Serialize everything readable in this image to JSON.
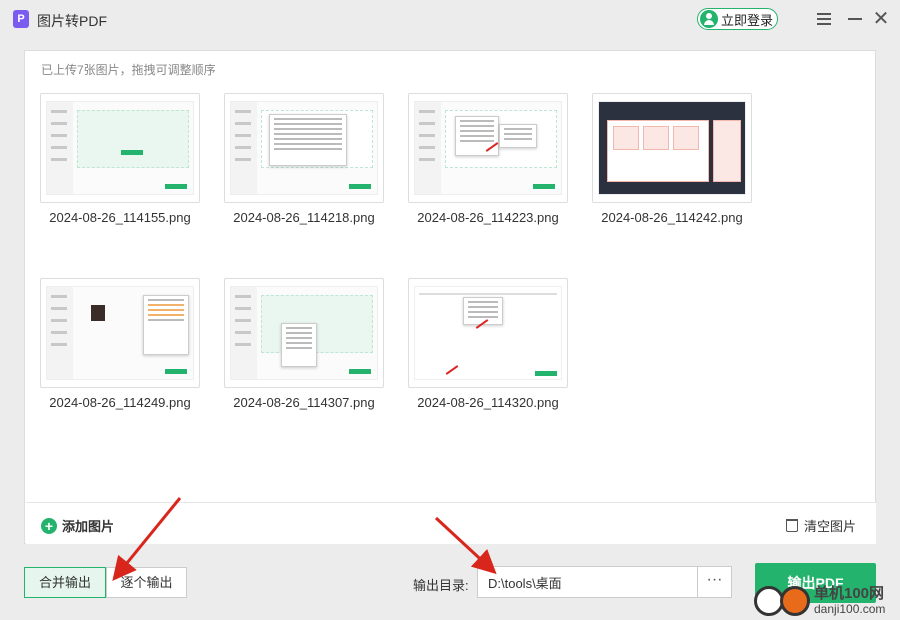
{
  "app": {
    "title": "图片转PDF",
    "icon_letter": "P",
    "login_label": "立即登录"
  },
  "panel": {
    "upload_hint": "已上传7张图片，拖拽可调整顺序"
  },
  "images": [
    {
      "filename": "2024-08-26_114155.png"
    },
    {
      "filename": "2024-08-26_114218.png"
    },
    {
      "filename": "2024-08-26_114223.png"
    },
    {
      "filename": "2024-08-26_114242.png"
    },
    {
      "filename": "2024-08-26_114249.png"
    },
    {
      "filename": "2024-08-26_114307.png"
    },
    {
      "filename": "2024-08-26_114320.png"
    }
  ],
  "toolbar": {
    "add_label": "添加图片",
    "clear_label": "清空图片"
  },
  "output": {
    "merge_label": "合并输出",
    "each_label": "逐个输出",
    "dir_label": "输出目录:",
    "dir_value": "D:\\tools\\桌面",
    "browse_label": "···",
    "export_label": "输出PDF"
  },
  "watermark": {
    "line1": "单机100网",
    "line2": "danji100.com"
  },
  "colors": {
    "accent": "#23b36d",
    "annotation": "#d9261c"
  }
}
